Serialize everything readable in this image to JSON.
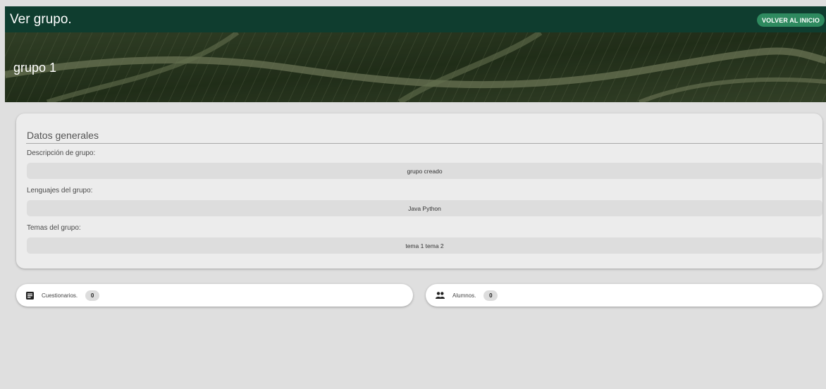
{
  "header": {
    "title": "Ver grupo.",
    "home_button": "VOLVER AL INICIO"
  },
  "banner": {
    "group_name": "grupo 1"
  },
  "general": {
    "section_title": "Datos generales",
    "fields": [
      {
        "label": "Descripción de grupo:",
        "value": "grupo creado"
      },
      {
        "label": "Lenguajes del grupo:",
        "value": "Java Python"
      },
      {
        "label": "Temas del grupo:",
        "value": "tema 1 tema 2"
      }
    ]
  },
  "summary": {
    "cuestionarios": {
      "label": "Cuestionarios.",
      "count": "0",
      "icon": "article-icon"
    },
    "alumnos": {
      "label": "Alumnos.",
      "count": "0",
      "icon": "people-icon"
    }
  },
  "colors": {
    "header_bg": "#0f3d2f",
    "button_bg": "#2e8a5f",
    "page_bg": "#dfdfdf"
  }
}
